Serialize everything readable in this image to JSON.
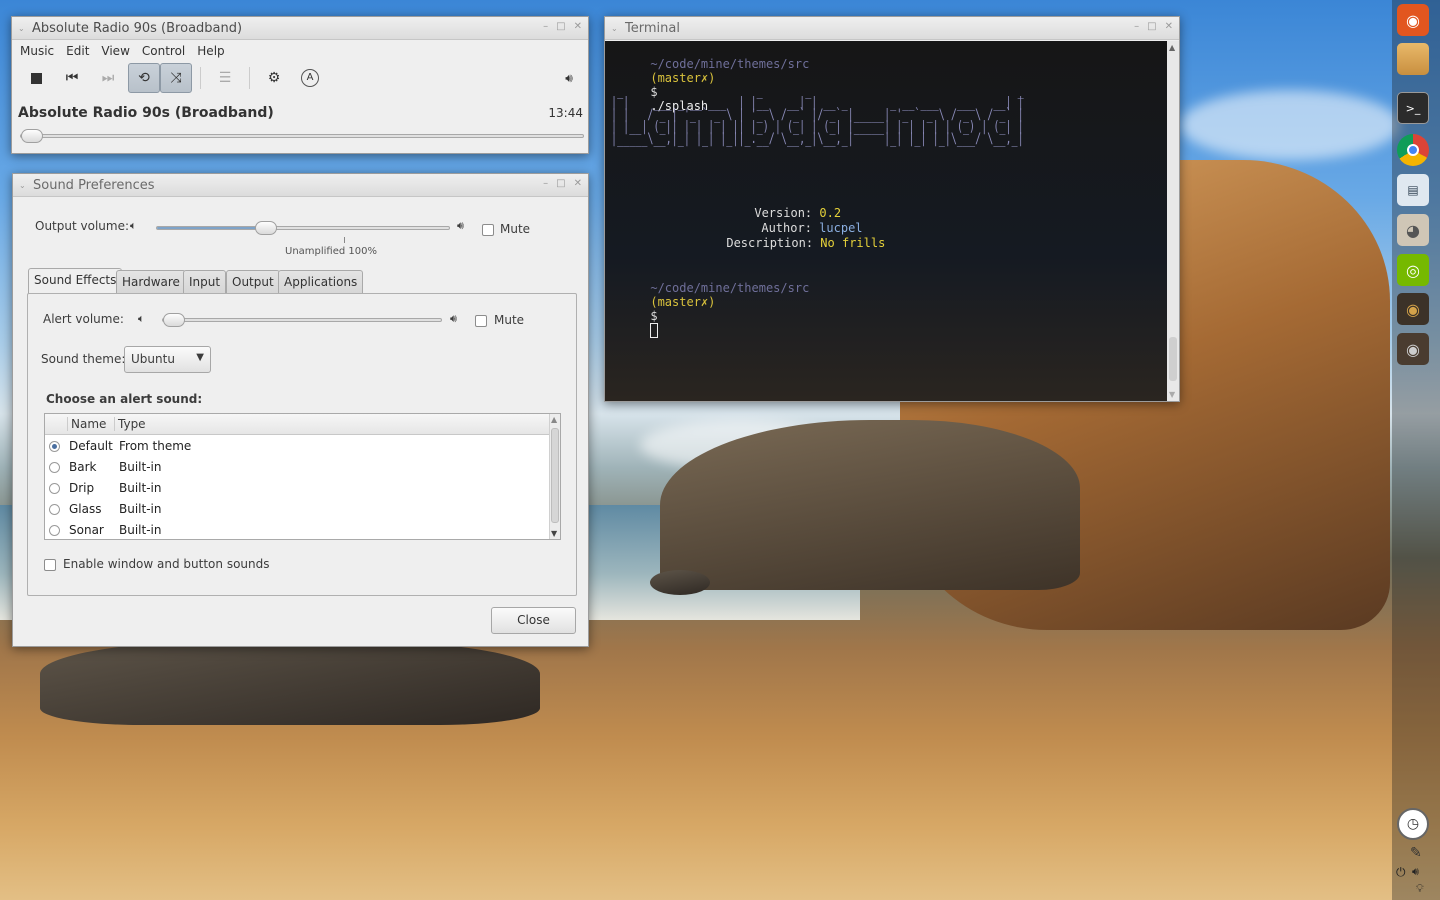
{
  "music_player": {
    "window_title": "Absolute Radio 90s (Broadband)",
    "menu": [
      "Music",
      "Edit",
      "View",
      "Control",
      "Help"
    ],
    "track_title": "Absolute Radio 90s (Broadband)",
    "elapsed": "13:44",
    "progress_fraction": 0.0
  },
  "sound_prefs": {
    "window_title": "Sound Preferences",
    "output_volume_label": "Output volume:",
    "output_volume_fraction": 0.38,
    "mute_label": "Mute",
    "unamplified_label": "Unamplified 100%",
    "tabs": [
      "Sound Effects",
      "Hardware",
      "Input",
      "Output",
      "Applications"
    ],
    "active_tab": "Sound Effects",
    "alert_volume_label": "Alert volume:",
    "alert_volume_fraction": 0.0,
    "alert_mute_label": "Mute",
    "sound_theme_label": "Sound theme:",
    "sound_theme_value": "Ubuntu",
    "choose_alert_label": "Choose an alert sound:",
    "columns": [
      "Name",
      "Type"
    ],
    "rows": [
      {
        "name": "Default",
        "type": "From theme",
        "selected": true
      },
      {
        "name": "Bark",
        "type": "Built-in",
        "selected": false
      },
      {
        "name": "Drip",
        "type": "Built-in",
        "selected": false
      },
      {
        "name": "Glass",
        "type": "Built-in",
        "selected": false
      },
      {
        "name": "Sonar",
        "type": "Built-in",
        "selected": false
      }
    ],
    "enable_sounds_label": "Enable window and button sounds",
    "close_label": "Close"
  },
  "terminal": {
    "window_title": "Terminal",
    "prompt_path": "~/code/mine/themes/src",
    "prompt_branch": "(master✗)",
    "prompt_symbol": "$",
    "command": "./splash",
    "banner": [
      " _                      _       _                                  _ ",
      "| |    ___ _ __ ___  | |__   __| | __ _       _ __ ___   ___   __| |",
      "| |   / _ | '_ ` _ \\ | '_ \\ / _` |/ _` |_____| '_ ` _ \\ / _ \\ / _` |",
      "| |__| (_|| | | | | || |_) | (_| | (_| |_____| | | | | | (_) | (_| |",
      "|_____\\__,|_| |_| |_||_.__/ \\__,_|\\__,_|     |_| |_| |_|\\___/ \\__,_|"
    ],
    "version_label": "Version:",
    "version_value": "0.2",
    "author_label": "Author:",
    "author_value": "lucpel",
    "description_label": "Description:",
    "description_value": "No frills"
  },
  "launcher": {
    "icons": [
      "ubuntu-icon",
      "folder-icon",
      "terminal-icon",
      "chrome-icon",
      "document-icon",
      "gimp-icon",
      "nvidia-icon",
      "speaker-icon",
      "speaker-icon"
    ]
  },
  "colors": {
    "prompt_path": "#6f6f9a",
    "prompt_branch": "#d9c23c",
    "banner": "#8a8ab8",
    "value_yellow": "#e5d13a",
    "value_blue": "#8aaee0",
    "selection_blue": "#4b6fa0"
  }
}
